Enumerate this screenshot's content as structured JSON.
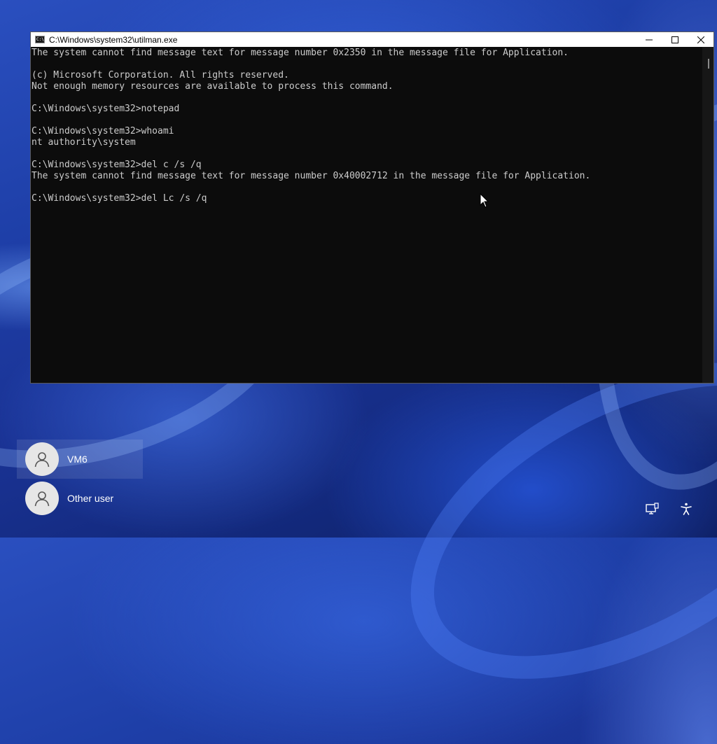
{
  "window": {
    "title": "C:\\Windows\\system32\\utilman.exe",
    "icon": "cmd-icon",
    "icon_glyph": "C:\\"
  },
  "console": {
    "lines": [
      "The system cannot find message text for message number 0x2350 in the message file for Application.",
      "",
      "(c) Microsoft Corporation. All rights reserved.",
      "Not enough memory resources are available to process this command.",
      "",
      "C:\\Windows\\system32>notepad",
      "",
      "C:\\Windows\\system32>whoami",
      "nt authority\\system",
      "",
      "C:\\Windows\\system32>del c /s /q",
      "The system cannot find message text for message number 0x40002712 in the message file for Application.",
      "",
      "C:\\Windows\\system32>del Lc /s /q"
    ],
    "text_color": "#cccccc",
    "background": "#0c0c0c"
  },
  "users": [
    {
      "name": "VM6",
      "selected": true
    },
    {
      "name": "Other user",
      "selected": false
    }
  ],
  "corner_icons": [
    "network-icon",
    "accessibility-icon"
  ]
}
